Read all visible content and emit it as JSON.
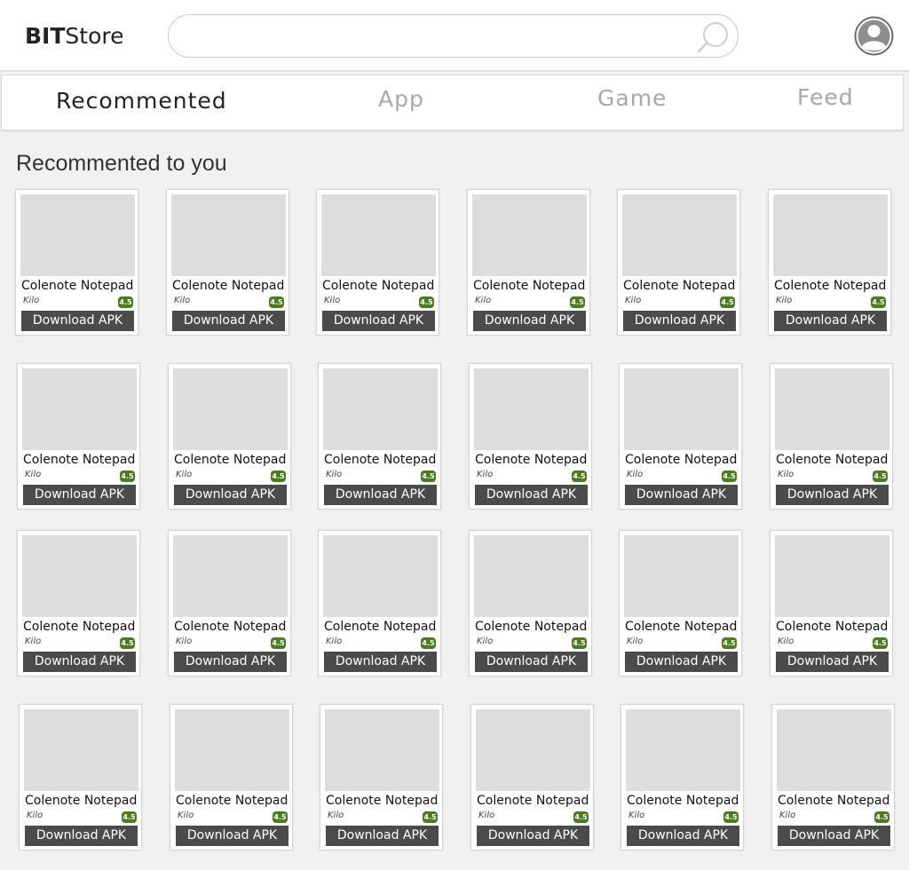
{
  "header": {
    "logo_bold": "BIT",
    "logo_light": "Store",
    "search": {
      "value": "",
      "placeholder": "",
      "icon": "search-icon"
    },
    "avatar_icon": "user-avatar-icon"
  },
  "tabs": [
    {
      "label": "Recommented",
      "active": true
    },
    {
      "label": "App",
      "active": false
    },
    {
      "label": "Game",
      "active": false
    },
    {
      "label": "Feed",
      "active": false
    }
  ],
  "section": {
    "title": "Recommented to you"
  },
  "apps": [
    {
      "name": "Colenote Notepad",
      "developer": "Kilo",
      "rating": "4.5",
      "button": "Download APK"
    },
    {
      "name": "Colenote Notepad",
      "developer": "Kilo",
      "rating": "4.5",
      "button": "Download APK"
    },
    {
      "name": "Colenote Notepad",
      "developer": "Kilo",
      "rating": "4.5",
      "button": "Download APK"
    },
    {
      "name": "Colenote Notepad",
      "developer": "Kilo",
      "rating": "4.5",
      "button": "Download APK"
    },
    {
      "name": "Colenote Notepad",
      "developer": "Kilo",
      "rating": "4.5",
      "button": "Download APK"
    },
    {
      "name": "Colenote Notepad",
      "developer": "Kilo",
      "rating": "4.5",
      "button": "Download APK"
    },
    {
      "name": "Colenote Notepad",
      "developer": "Kilo",
      "rating": "4.5",
      "button": "Download APK"
    },
    {
      "name": "Colenote Notepad",
      "developer": "Kilo",
      "rating": "4.5",
      "button": "Download APK"
    },
    {
      "name": "Colenote Notepad",
      "developer": "Kilo",
      "rating": "4.5",
      "button": "Download APK"
    },
    {
      "name": "Colenote Notepad",
      "developer": "Kilo",
      "rating": "4.5",
      "button": "Download APK"
    },
    {
      "name": "Colenote Notepad",
      "developer": "Kilo",
      "rating": "4.5",
      "button": "Download APK"
    },
    {
      "name": "Colenote Notepad",
      "developer": "Kilo",
      "rating": "4.5",
      "button": "Download APK"
    },
    {
      "name": "Colenote Notepad",
      "developer": "Kilo",
      "rating": "4.5",
      "button": "Download APK"
    },
    {
      "name": "Colenote Notepad",
      "developer": "Kilo",
      "rating": "4.5",
      "button": "Download APK"
    },
    {
      "name": "Colenote Notepad",
      "developer": "Kilo",
      "rating": "4.5",
      "button": "Download APK"
    },
    {
      "name": "Colenote Notepad",
      "developer": "Kilo",
      "rating": "4.5",
      "button": "Download APK"
    },
    {
      "name": "Colenote Notepad",
      "developer": "Kilo",
      "rating": "4.5",
      "button": "Download APK"
    },
    {
      "name": "Colenote Notepad",
      "developer": "Kilo",
      "rating": "4.5",
      "button": "Download APK"
    },
    {
      "name": "Colenote Notepad",
      "developer": "Kilo",
      "rating": "4.5",
      "button": "Download APK"
    },
    {
      "name": "Colenote Notepad",
      "developer": "Kilo",
      "rating": "4.5",
      "button": "Download APK"
    },
    {
      "name": "Colenote Notepad",
      "developer": "Kilo",
      "rating": "4.5",
      "button": "Download APK"
    },
    {
      "name": "Colenote Notepad",
      "developer": "Kilo",
      "rating": "4.5",
      "button": "Download APK"
    },
    {
      "name": "Colenote Notepad",
      "developer": "Kilo",
      "rating": "4.5",
      "button": "Download APK"
    },
    {
      "name": "Colenote Notepad",
      "developer": "Kilo",
      "rating": "4.5",
      "button": "Download APK"
    }
  ],
  "colors": {
    "rating_badge": "#4a7d1d",
    "download_button": "#4b4b4b",
    "thumbnail_placeholder": "#dddddd",
    "page_background": "#f1f1f1"
  }
}
